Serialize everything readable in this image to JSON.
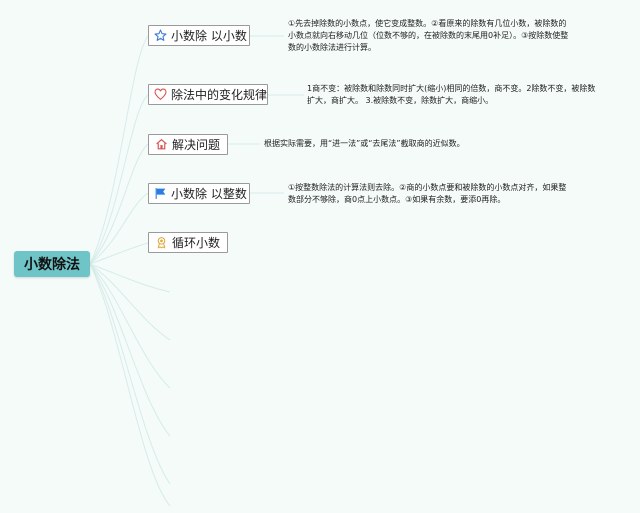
{
  "root": {
    "label": "小数除法"
  },
  "topics": [
    {
      "label": "小数除 以小数",
      "icon": "star-icon",
      "icon_color": "#3a7bd5"
    },
    {
      "label": "除法中的变化规律",
      "icon": "heart-icon",
      "icon_color": "#d9534f"
    },
    {
      "label": "解决问题",
      "icon": "house-icon",
      "icon_color": "#d9534f"
    },
    {
      "label": "小数除 以整数",
      "icon": "flag-icon",
      "icon_color": "#2a7de1"
    },
    {
      "label": "循环小数",
      "icon": "award-icon",
      "icon_color": "#e0a93b"
    }
  ],
  "notes": [
    {
      "lines": [
        "①先去掉除数的小数点，使它变成整数。②看原来的除数有几位小数，被除数的",
        "小数点就向右移动几位（位数不够的，在被除数的末尾用0补足）。③按除数使整",
        "数的小数除法进行计算。"
      ]
    },
    {
      "lines": [
        "1商不变：被除数和除数同时扩大(缩小)相同的倍数，商不变。2除数不变，被除数",
        "扩大，商扩大。 3.被除数不变，除数扩大，商缩小。"
      ]
    },
    {
      "lines": [
        "根据实际需要，用“进一法”或“去尾法”截取商的近似数。"
      ]
    },
    {
      "lines": [
        "①按整数除法的计算法则去除。②商的小数点要和被除数的小数点对齐，如果整",
        "数部分不够除，商0点上小数点。③如果有余数，要添0再除。"
      ]
    }
  ],
  "colors": {
    "background": "#f4fbf9",
    "root": "#6ec4c6",
    "link": "#d6ecea"
  }
}
